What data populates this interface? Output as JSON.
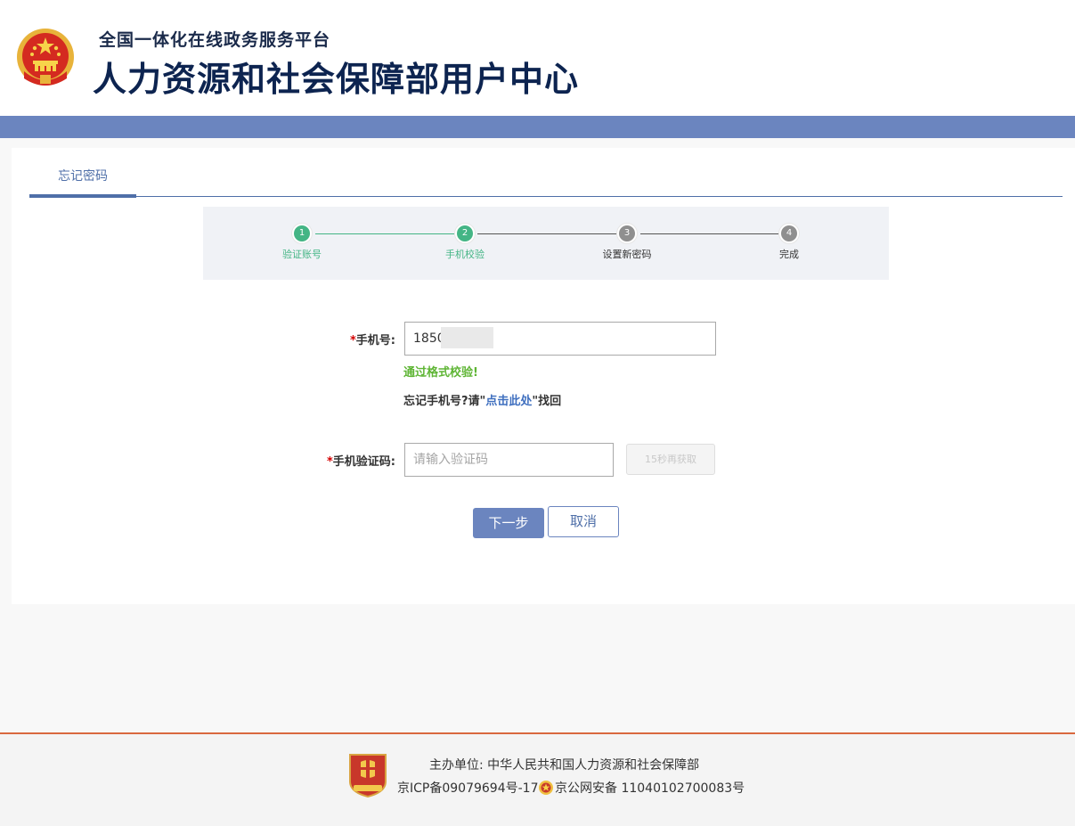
{
  "header": {
    "subtitle": "全国一体化在线政务服务平台",
    "title": "人力资源和社会保障部用户中心",
    "emblem_icon": "national-emblem-icon"
  },
  "tabs": [
    {
      "label": "忘记密码"
    }
  ],
  "steps": [
    {
      "number": "1",
      "label": "验证账号",
      "status": "done"
    },
    {
      "number": "2",
      "label": "手机校验",
      "status": "done"
    },
    {
      "number": "3",
      "label": "设置新密码",
      "status": "todo"
    },
    {
      "number": "4",
      "label": "完成",
      "status": "todo"
    }
  ],
  "form": {
    "phone": {
      "required_mark": "*",
      "label": "手机号:",
      "value": "1850"
    },
    "valid_message": "通过格式校验!",
    "forgot_prefix": "忘记手机号?请\"",
    "forgot_link": "点击此处",
    "forgot_suffix": "\"找回",
    "code": {
      "required_mark": "*",
      "label": "手机验证码:",
      "placeholder": "请输入验证码",
      "value": ""
    },
    "resend_label": "15秒再获取"
  },
  "buttons": {
    "next": "下一步",
    "cancel": "取消"
  },
  "footer": {
    "sponsor": "主办单位: 中华人民共和国人力资源和社会保障部",
    "icp": "京ICP备09079694号-17",
    "police": "京公网安备 11040102700083号",
    "badge_icon": "party-government-badge-icon",
    "police_icon": "police-badge-icon"
  },
  "colors": {
    "brand_blue": "#6b85bf",
    "step_done": "#44b585",
    "step_todo": "#8f8f8f",
    "valid_green": "#5eb534",
    "required_red": "#d40000",
    "footer_accent": "#d9683f"
  }
}
